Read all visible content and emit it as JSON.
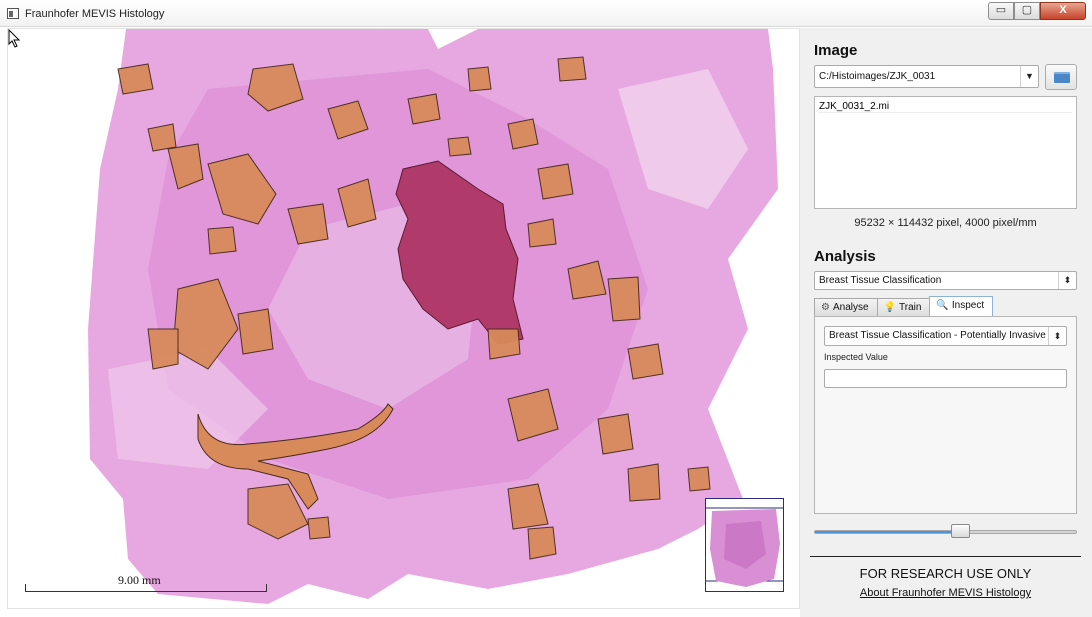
{
  "window": {
    "title": "Fraunhofer MEVIS Histology",
    "minimize": "▭",
    "maximize": "▢",
    "close": "X"
  },
  "viewer": {
    "scalebar_label": "9.00 mm"
  },
  "image_section": {
    "title": "Image",
    "directory": "C:/Histoimages/ZJK_0031",
    "files": [
      "ZJK_0031_2.mi"
    ],
    "dimensions": "95232 × 114432 pixel,  4000 pixel/mm"
  },
  "analysis_section": {
    "title": "Analysis",
    "method": "Breast Tissue Classification",
    "tabs": [
      {
        "label": "Analyse",
        "icon": "gear-icon",
        "glyph": "⚙"
      },
      {
        "label": "Train",
        "icon": "lightbulb-icon",
        "glyph": "💡"
      },
      {
        "label": "Inspect",
        "icon": "magnifier-icon",
        "glyph": "🔍"
      }
    ],
    "active_tab": "Inspect",
    "inspect": {
      "selection": "Breast Tissue Classification - Potentially Invasive",
      "value_label": "Inspected Value",
      "value": ""
    }
  },
  "slider": {
    "value": 0.56
  },
  "footer": {
    "notice": "FOR RESEARCH USE ONLY",
    "about_link": "About Fraunhofer MEVIS Histology"
  },
  "colors": {
    "tissue": "#e39be0",
    "tissue_dark": "#cf6fc9",
    "region_orange": "#d88a5a",
    "region_dark": "#b03b6a",
    "accent": "#4d93d9"
  }
}
